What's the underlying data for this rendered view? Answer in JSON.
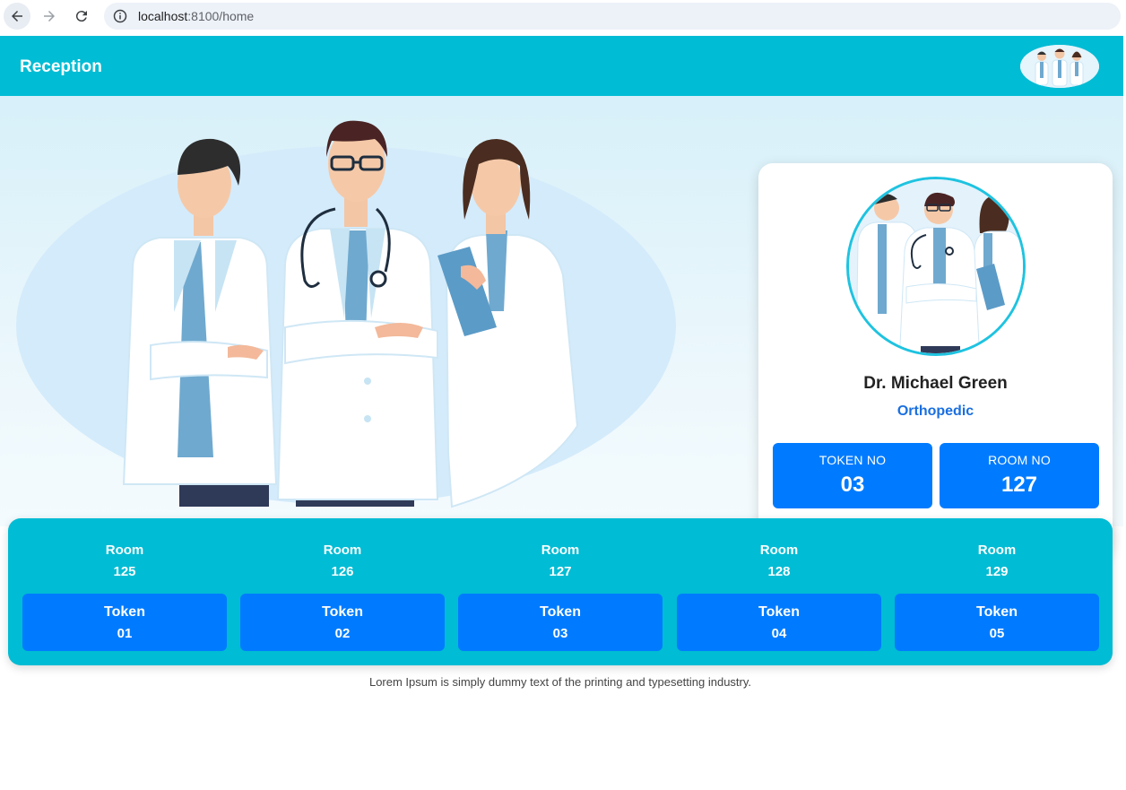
{
  "browser": {
    "url_host": "localhost",
    "url_rest": ":8100/home"
  },
  "header": {
    "title": "Reception"
  },
  "doctor": {
    "name": "Dr. Michael Green",
    "specialty": "Orthopedic",
    "token_label": "TOKEN NO",
    "token_value": "03",
    "room_label": "ROOM NO",
    "room_value": "127"
  },
  "rooms": [
    {
      "room_label": "Room",
      "room": "125",
      "token_label": "Token",
      "token": "01"
    },
    {
      "room_label": "Room",
      "room": "126",
      "token_label": "Token",
      "token": "02"
    },
    {
      "room_label": "Room",
      "room": "127",
      "token_label": "Token",
      "token": "03"
    },
    {
      "room_label": "Room",
      "room": "128",
      "token_label": "Token",
      "token": "04"
    },
    {
      "room_label": "Room",
      "room": "129",
      "token_label": "Token",
      "token": "05"
    }
  ],
  "footer": {
    "text": "Lorem Ipsum is simply dummy text of the printing and typesetting industry."
  },
  "colors": {
    "header": "#00bcd4",
    "accent_blue": "#007bff",
    "specialty": "#1a6fe0"
  }
}
